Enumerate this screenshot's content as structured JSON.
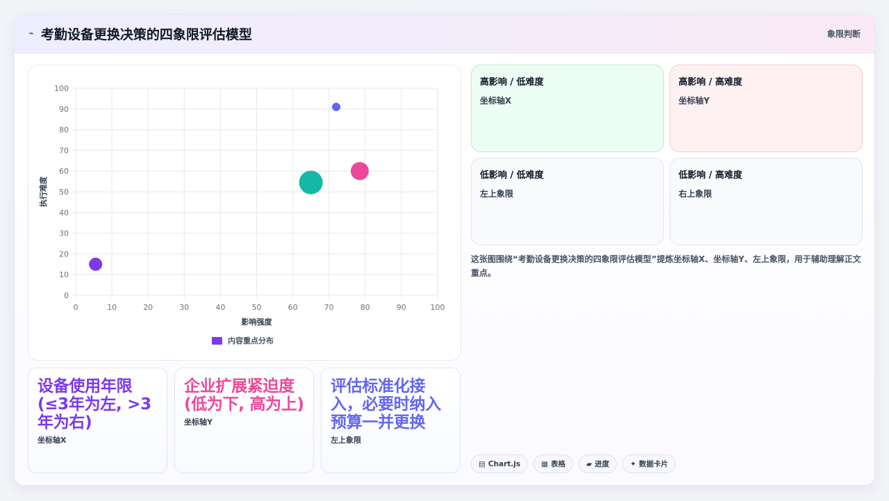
{
  "header": {
    "title": "考勤设备更换决策的四象限评估模型",
    "tag": "象限判断"
  },
  "chart_data": {
    "type": "bubble",
    "xlabel": "影响强度",
    "ylabel": "执行难度",
    "xlim": [
      0,
      100
    ],
    "ylim": [
      0,
      100
    ],
    "xticks": [
      0,
      10,
      20,
      30,
      40,
      50,
      60,
      70,
      80,
      90,
      100
    ],
    "yticks": [
      0,
      10,
      20,
      30,
      40,
      50,
      60,
      70,
      80,
      90,
      100
    ],
    "grid": true,
    "legend_position": "bottom",
    "series": [
      {
        "name": "内容重点分布",
        "points": [
          {
            "x": 72,
            "y": 91,
            "r": 6,
            "color": "#6366f1"
          },
          {
            "x": 78.5,
            "y": 60,
            "r": 13,
            "color": "#ec4899"
          },
          {
            "x": 65,
            "y": 54.5,
            "r": 17,
            "color": "#14b8a6"
          },
          {
            "x": 5.5,
            "y": 15,
            "r": 9.5,
            "color": "#7c3aed"
          }
        ]
      }
    ]
  },
  "stats": [
    {
      "value": "设备使用年限(≤3年为左, >3年为右)",
      "label": "坐标轴X",
      "color": "#7c3aed"
    },
    {
      "value": "企业扩展紧迫度(低为下, 高为上)",
      "label": "坐标轴Y",
      "color": "#ec4899"
    },
    {
      "value": "评估标准化接入，必要时纳入预算一并更换",
      "label": "左上象限",
      "color": "#6366f1"
    }
  ],
  "quadrants": [
    {
      "title": "高影响 / 低难度",
      "sub": "坐标轴X",
      "bg": "#ecfdf3",
      "border": "#bfe9d2"
    },
    {
      "title": "高影响 / 高难度",
      "sub": "坐标轴Y",
      "bg": "#fff1f2",
      "border": "#f5c9d2"
    },
    {
      "title": "低影响 / 低难度",
      "sub": "左上象限",
      "bg": "#f8fafc",
      "border": "#dfe6f2"
    },
    {
      "title": "低影响 / 高难度",
      "sub": "右上象限",
      "bg": "#f8fafc",
      "border": "#dfe6f2"
    }
  ],
  "description": "这张图围绕“考勤设备更换决策的四象限评估模型”提炼坐标轴X、坐标轴Y、左上象限，用于辅助理解正文重点。",
  "chips": [
    {
      "icon": "▤",
      "icon_name": "chart-icon",
      "label": "Chart.js"
    },
    {
      "icon": "▦",
      "icon_name": "table-icon",
      "label": "表格"
    },
    {
      "icon": "▰",
      "icon_name": "progress-icon",
      "label": "进度"
    },
    {
      "icon": "✦",
      "icon_name": "sparkle-icon",
      "label": "数据卡片"
    }
  ]
}
